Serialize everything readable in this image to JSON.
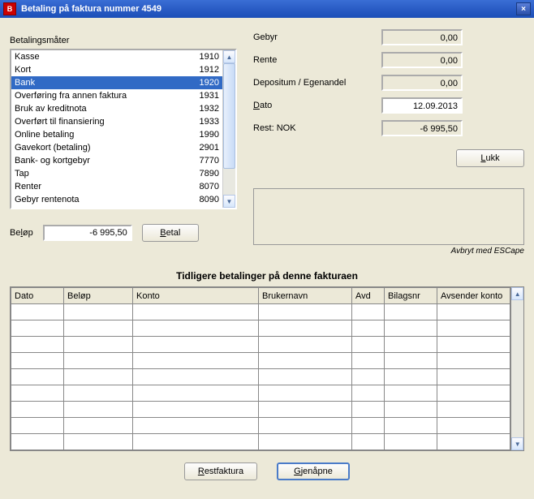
{
  "title": "Betaling på faktura nummer 4549",
  "close_symbol": "×",
  "payment_methods": {
    "label": "Betalingsmåter",
    "items": [
      {
        "name": "Kasse",
        "code": "1910",
        "selected": false
      },
      {
        "name": "Kort",
        "code": "1912",
        "selected": false
      },
      {
        "name": "Bank",
        "code": "1920",
        "selected": true
      },
      {
        "name": "Overføring fra annen faktura",
        "code": "1931",
        "selected": false
      },
      {
        "name": "Bruk av kreditnota",
        "code": "1932",
        "selected": false
      },
      {
        "name": "Overført til finansiering",
        "code": "1933",
        "selected": false
      },
      {
        "name": "Online betaling",
        "code": "1990",
        "selected": false
      },
      {
        "name": "Gavekort (betaling)",
        "code": "2901",
        "selected": false
      },
      {
        "name": "Bank- og kortgebyr",
        "code": "7770",
        "selected": false
      },
      {
        "name": "Tap",
        "code": "7890",
        "selected": false
      },
      {
        "name": "Renter",
        "code": "8070",
        "selected": false
      },
      {
        "name": "Gebyr rentenota",
        "code": "8090",
        "selected": false
      }
    ]
  },
  "amount": {
    "label_pre": "Be",
    "label_u": "l",
    "label_post": "øp",
    "value": "-6 995,50"
  },
  "buttons": {
    "betal_pre": "",
    "betal_u": "B",
    "betal_post": "etal",
    "lukk_pre": "",
    "lukk_u": "L",
    "lukk_post": "ukk",
    "restfaktura_pre": "",
    "restfaktura_u": "R",
    "restfaktura_post": "estfaktura",
    "gjenopne_pre": "",
    "gjenopne_u": "G",
    "gjenopne_post": "jenåpne"
  },
  "summary": {
    "gebyr_label": "Gebyr",
    "gebyr_value": "0,00",
    "rente_label": "Rente",
    "rente_value": "0,00",
    "depositum_label": "Depositum / Egenandel",
    "depositum_value": "0,00",
    "dato_label_u": "D",
    "dato_label_post": "ato",
    "dato_value": "12.09.2013",
    "rest_label": "Rest: NOK",
    "rest_value": "-6 995,50"
  },
  "escape_note": "Avbryt med ESCape",
  "history": {
    "title": "Tidligere betalinger på denne fakturaen",
    "columns": {
      "dato": "Dato",
      "belop": "Beløp",
      "konto": "Konto",
      "brukernavn": "Brukernavn",
      "avd": "Avd",
      "bilagsnr": "Bilagsnr",
      "avsender": "Avsender konto"
    },
    "rows": 9
  },
  "scroll": {
    "up": "▲",
    "down": "▼"
  }
}
